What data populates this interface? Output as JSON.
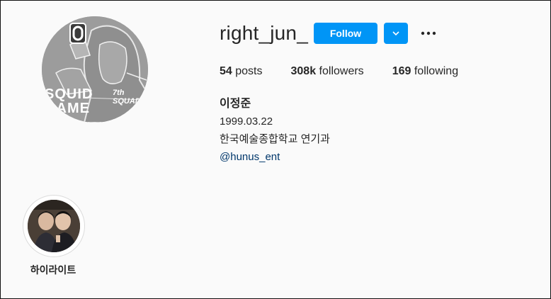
{
  "profile": {
    "username": "right_jun_",
    "avatar_text": "SQUID GAME",
    "avatar_badge": "7th SQUAD",
    "follow_label": "Follow",
    "stats": {
      "posts_count": "54",
      "posts_label": "posts",
      "followers_count": "308k",
      "followers_label": "followers",
      "following_count": "169",
      "following_label": "following"
    },
    "bio": {
      "name": "이정준",
      "line1": "1999.03.22",
      "line2": "한국예술종합학교 연기과",
      "link": "@hunus_ent"
    }
  },
  "highlights": [
    {
      "label": "하이라이트"
    }
  ],
  "colors": {
    "accent": "#0095f6",
    "link": "#00376b",
    "background": "#fafafa"
  },
  "icons": [
    "chevron-down-icon",
    "more-options-icon"
  ]
}
